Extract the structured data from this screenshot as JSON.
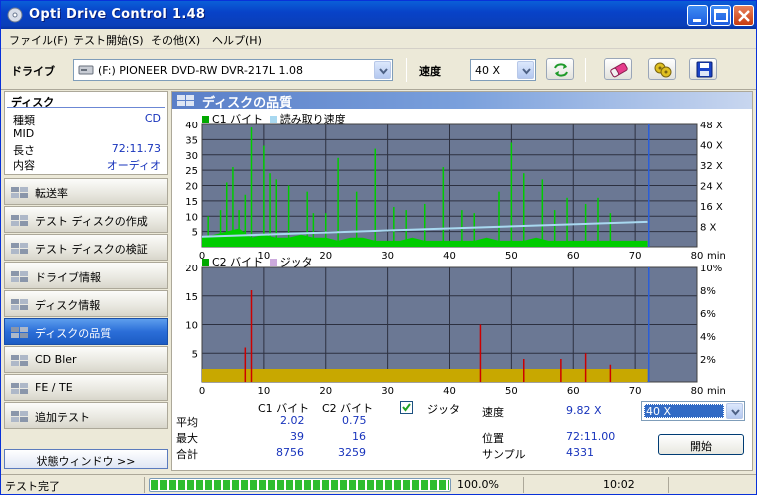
{
  "window": {
    "title": "Opti Drive Control 1.48"
  },
  "menu": [
    "ファイル(F)",
    "テスト開始(S)",
    "その他(X)",
    "ヘルプ(H)"
  ],
  "toolbar": {
    "drive_label": "ドライブ",
    "drive_value": "(F:)    PIONEER DVD-RW  DVR-217L 1.08",
    "speed_label": "速度",
    "speed_value": "40 X"
  },
  "disc": {
    "header": "ディスク",
    "rows": [
      {
        "k": "種類",
        "v": "CD"
      },
      {
        "k": "MID",
        "v": ""
      },
      {
        "k": "長さ",
        "v": "72:11.73"
      },
      {
        "k": "内容",
        "v": "オーディオ"
      }
    ]
  },
  "nav": [
    {
      "label": "転送率",
      "active": false
    },
    {
      "label": "テスト ディスクの作成",
      "active": false
    },
    {
      "label": "テスト ディスクの検証",
      "active": false
    },
    {
      "label": "ドライブ情報",
      "active": false
    },
    {
      "label": "ディスク情報",
      "active": false
    },
    {
      "label": "ディスクの品質",
      "active": true
    },
    {
      "label": "CD Bler",
      "active": false
    },
    {
      "label": "FE / TE",
      "active": false
    },
    {
      "label": "追加テスト",
      "active": false
    }
  ],
  "status_window_button": "状態ウィンドウ >>",
  "main": {
    "title": "ディスクの品質",
    "legend_top": [
      "C1 バイト",
      "読み取り速度"
    ],
    "legend_bottom": [
      "C2 バイト",
      "ジッタ"
    ],
    "unit": "min"
  },
  "stats": {
    "col_c1": "C1 バイト",
    "col_c2": "C2 バイト",
    "jitter_label": "ジッタ",
    "rows": [
      {
        "k": "平均",
        "c1": "2.02",
        "c2": "0.75"
      },
      {
        "k": "最大",
        "c1": "39",
        "c2": "16"
      },
      {
        "k": "合計",
        "c1": "8756",
        "c2": "3259"
      }
    ],
    "speed_label": "速度",
    "speed_value": "9.82 X",
    "speed_select": "40 X",
    "pos_label": "位置",
    "pos_value": "72:11.00",
    "sample_label": "サンプル",
    "sample_value": "4331",
    "start_button": "開始"
  },
  "statusbar": {
    "text": "テスト完了",
    "progress_pct": 100,
    "progress_text": "100.0%",
    "time": "10:02"
  },
  "colors": {
    "c1": "#00cc00",
    "read_speed": "#a8d8f0",
    "c2": "#cc0000",
    "jitter": "#ccaadd",
    "plot_bg": "#6b7894",
    "c2_floor": "#c8a800"
  },
  "chart_data": [
    {
      "type": "bar",
      "title": "",
      "series": [
        {
          "name": "C1 バイト",
          "x": [
            0,
            2,
            4,
            6,
            8,
            10,
            12,
            14,
            16,
            18,
            20,
            22,
            24,
            26,
            28,
            30,
            32,
            34,
            36,
            38,
            40,
            42,
            44,
            46,
            48,
            50,
            52,
            54,
            56,
            58,
            60,
            62,
            64,
            66,
            68,
            70,
            72
          ],
          "values": [
            3,
            4,
            5,
            6,
            3,
            4,
            3,
            3,
            4,
            3,
            3,
            2,
            3,
            3,
            2,
            2,
            2,
            3,
            2,
            2,
            2,
            2,
            2,
            3,
            2,
            2,
            2,
            3,
            2,
            2,
            2,
            2,
            2,
            2,
            2,
            2,
            2
          ]
        },
        {
          "name": "読み取り速度",
          "x": [
            0,
            72
          ],
          "values": [
            4.0,
            9.8
          ]
        }
      ],
      "peaks_x": [
        1,
        3,
        4,
        5,
        6,
        7,
        8,
        10,
        11,
        12,
        14,
        17,
        18,
        20,
        22,
        25,
        28,
        31,
        33,
        36,
        39,
        42,
        44,
        48,
        50,
        52,
        55,
        57,
        59,
        62,
        64,
        66
      ],
      "peaks_y": [
        10,
        12,
        21,
        26,
        12,
        17,
        39,
        33,
        24,
        22,
        20,
        18,
        11,
        11,
        29,
        18,
        32,
        13,
        12,
        14,
        26,
        12,
        11,
        18,
        34,
        24,
        22,
        12,
        16,
        14,
        16,
        11
      ],
      "xlim": [
        0,
        80
      ],
      "ylim": [
        0,
        40
      ],
      "x_ticks": [
        0,
        10,
        20,
        30,
        40,
        50,
        60,
        70,
        80
      ],
      "y_ticks": [
        5,
        10,
        15,
        20,
        25,
        30,
        35,
        40
      ],
      "y2_ticks": [
        "8 X",
        "16 X",
        "24 X",
        "32 X",
        "40 X",
        "48 X"
      ]
    },
    {
      "type": "bar",
      "title": "",
      "series": [
        {
          "name": "C2 バイト",
          "x": [
            7,
            8,
            45,
            52,
            58,
            62,
            66
          ],
          "values": [
            6,
            16,
            10,
            4,
            4,
            5,
            3
          ]
        },
        {
          "name": "ジッタ",
          "x": [],
          "values": []
        }
      ],
      "xlim": [
        0,
        80
      ],
      "ylim": [
        0,
        20
      ],
      "x_ticks": [
        0,
        10,
        20,
        30,
        40,
        50,
        60,
        70,
        80
      ],
      "y_ticks": [
        5,
        10,
        15,
        20
      ],
      "y2_ticks": [
        "2%",
        "4%",
        "6%",
        "8%",
        "10%"
      ]
    }
  ]
}
